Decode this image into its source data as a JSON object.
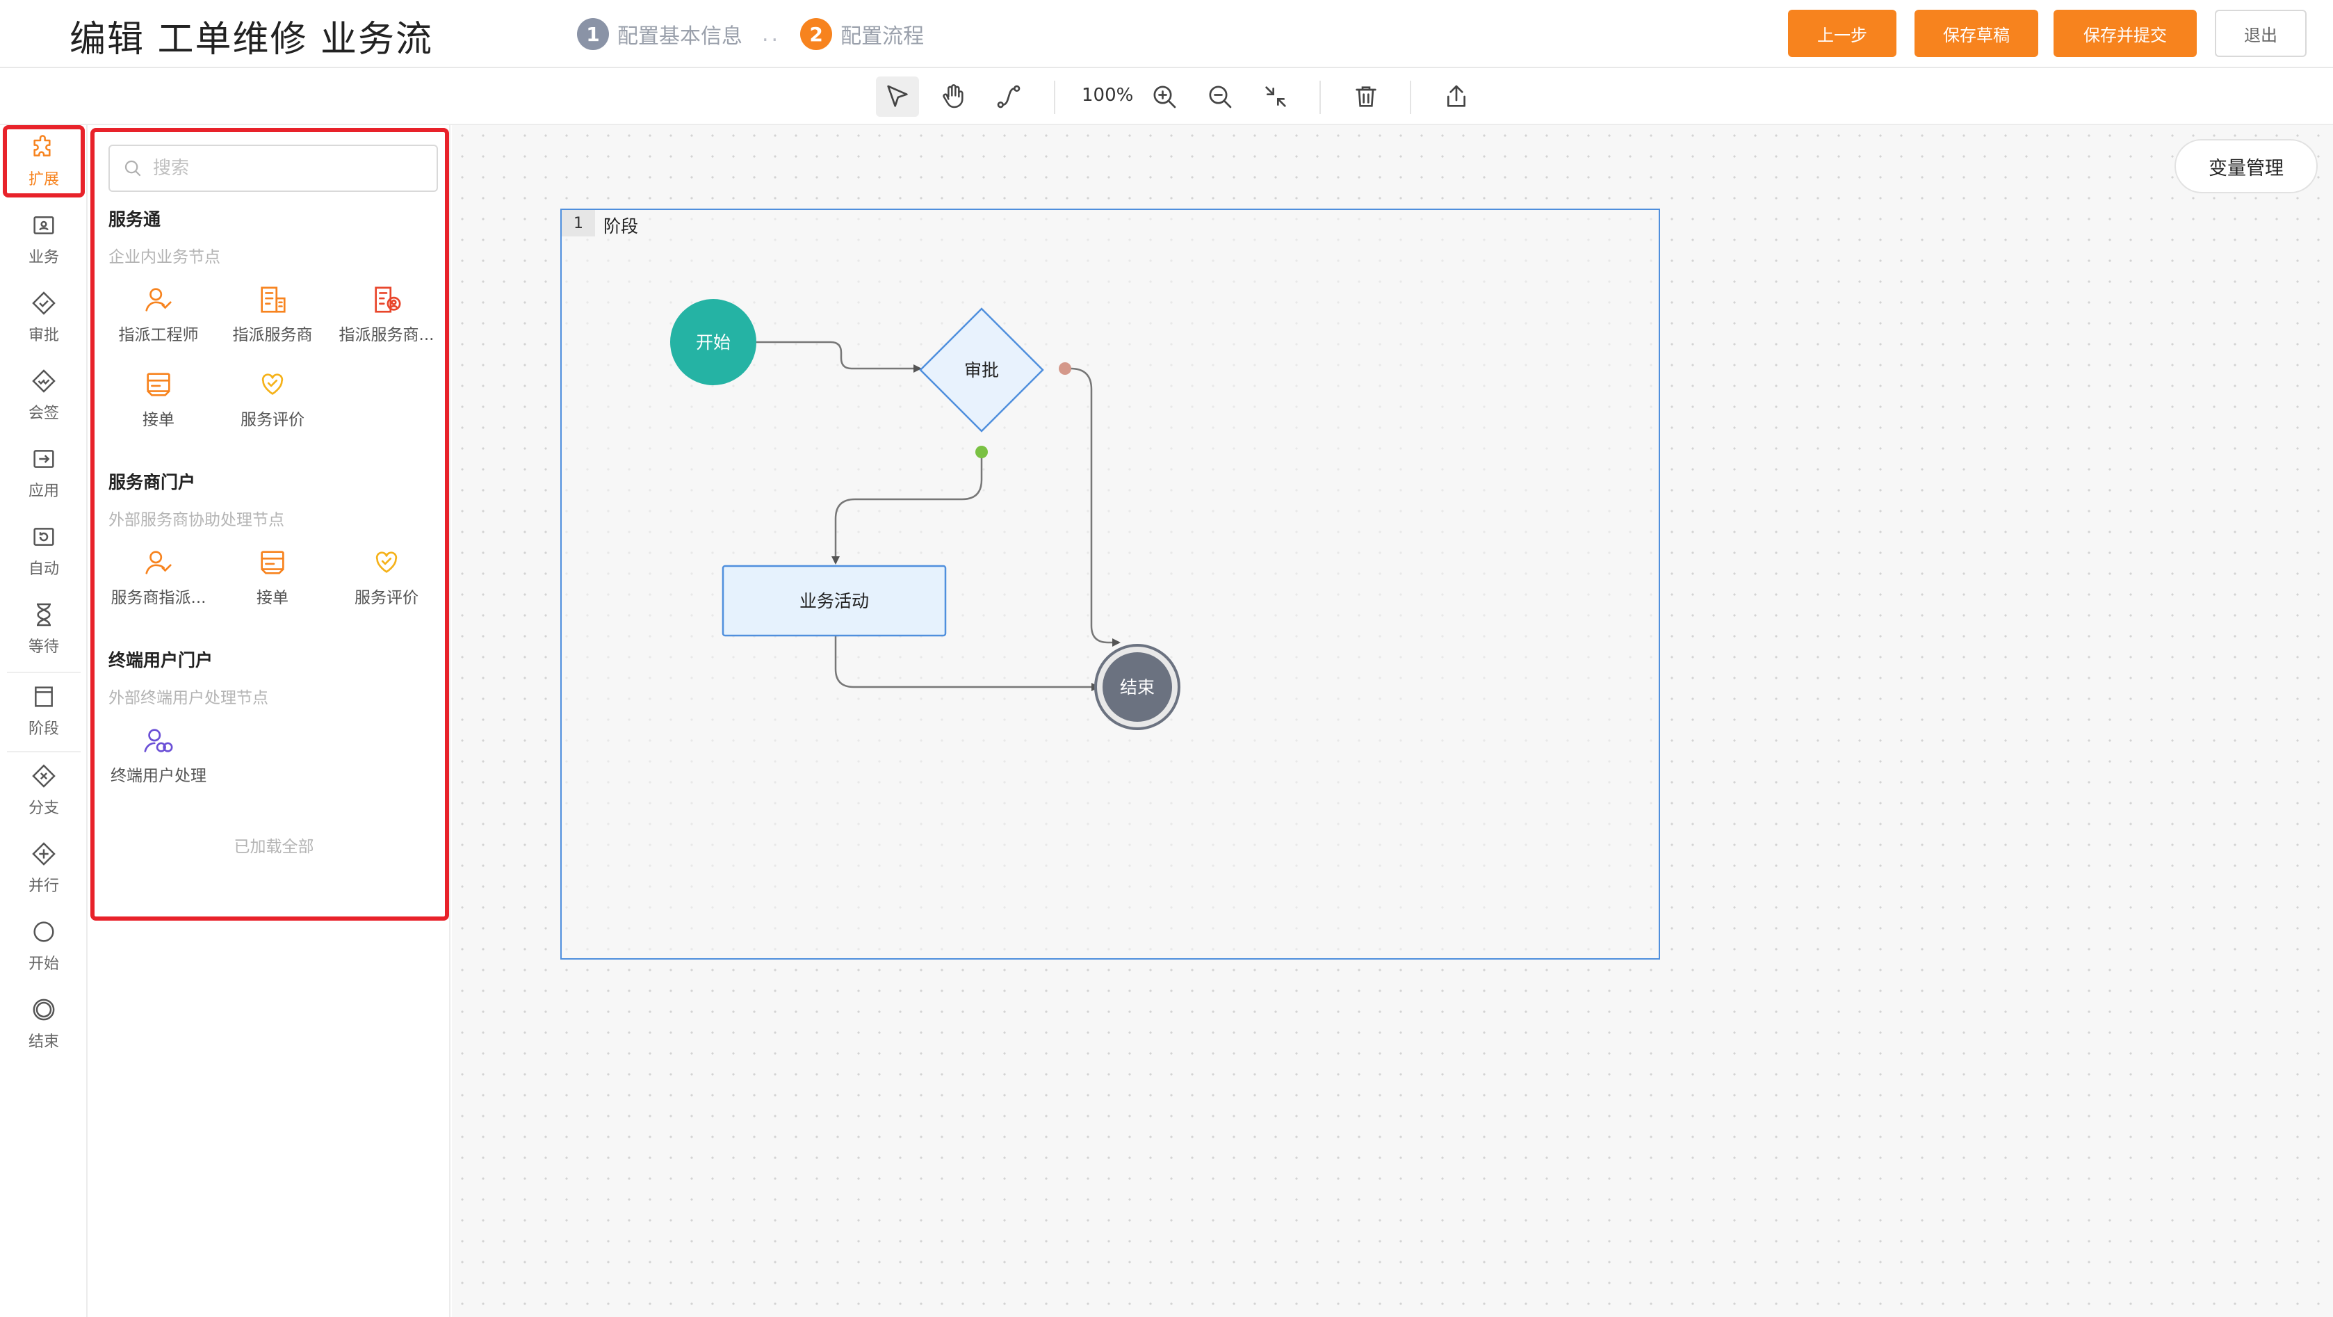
{
  "header": {
    "title": "编辑 工单维修 业务流",
    "steps": [
      {
        "num": "1",
        "label": "配置基本信息",
        "state": "done"
      },
      {
        "num": "2",
        "label": "配置流程",
        "state": "active"
      }
    ],
    "step_separator": "..",
    "buttons": {
      "prev": "上一步",
      "save_draft": "保存草稿",
      "save_submit": "保存并提交",
      "exit": "退出"
    },
    "accent": "#f7831e"
  },
  "toolbar": {
    "zoom": "100%",
    "icons": [
      "select-cursor-icon",
      "hand-pan-icon",
      "connect-line-icon",
      "zoom-in-icon",
      "zoom-out-icon",
      "fit-view-icon",
      "delete-icon",
      "export-icon"
    ]
  },
  "rail": {
    "items": [
      {
        "label": "扩展",
        "icon": "puzzle-icon"
      },
      {
        "label": "业务",
        "icon": "business-icon"
      },
      {
        "label": "审批",
        "icon": "approval-icon"
      },
      {
        "label": "会签",
        "icon": "countersign-icon"
      },
      {
        "label": "应用",
        "icon": "app-icon"
      },
      {
        "label": "自动",
        "icon": "auto-icon"
      },
      {
        "label": "等待",
        "icon": "hourglass-icon"
      },
      {
        "label": "阶段",
        "icon": "stage-icon"
      },
      {
        "label": "分支",
        "icon": "branch-icon"
      },
      {
        "label": "并行",
        "icon": "parallel-icon"
      },
      {
        "label": "开始",
        "icon": "start-circle-icon"
      },
      {
        "label": "结束",
        "icon": "end-circle-icon"
      }
    ]
  },
  "palette": {
    "search_placeholder": "搜索",
    "sections": [
      {
        "title": "服务通",
        "desc": "企业内业务节点",
        "items": [
          {
            "label": "指派工程师",
            "icon": "assign-engineer-icon"
          },
          {
            "label": "指派服务商",
            "icon": "assign-provider-icon"
          },
          {
            "label": "指派服务商...",
            "icon": "assign-provider-person-icon"
          },
          {
            "label": "接单",
            "icon": "accept-order-icon"
          },
          {
            "label": "服务评价",
            "icon": "service-rating-icon"
          }
        ]
      },
      {
        "title": "服务商门户",
        "desc": "外部服务商协助处理节点",
        "items": [
          {
            "label": "服务商指派...",
            "icon": "provider-assign-icon"
          },
          {
            "label": "接单",
            "icon": "accept-order-icon"
          },
          {
            "label": "服务评价",
            "icon": "service-rating-icon"
          }
        ]
      },
      {
        "title": "终端用户门户",
        "desc": "外部终端用户处理节点",
        "items": [
          {
            "label": "终端用户处理",
            "icon": "end-user-icon"
          }
        ]
      }
    ],
    "loaded_text": "已加载全部"
  },
  "canvas": {
    "variable_button": "变量管理",
    "stage": {
      "number": "1",
      "label": "阶段"
    },
    "nodes": {
      "start": "开始",
      "approval": "审批",
      "activity": "业务活动",
      "end": "结束"
    },
    "colors": {
      "start": "#25b3a4",
      "end": "#6b7280",
      "activity_fill": "#e6f2fd",
      "approval_border": "#4f8fdd",
      "yes_port": "#7ac143",
      "no_port": "#d4988a"
    }
  }
}
